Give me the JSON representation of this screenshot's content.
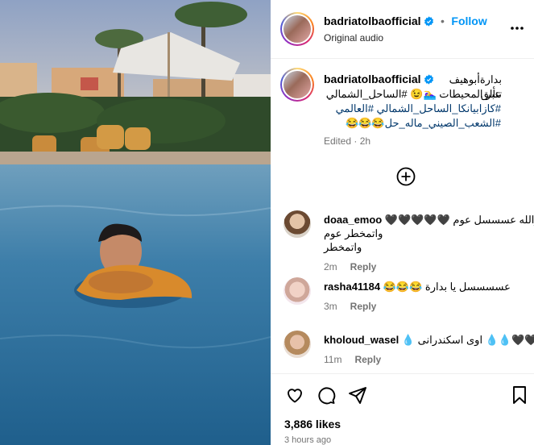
{
  "post": {
    "username": "badriatolbaofficial",
    "follow_label": "Follow",
    "audio_label": "Original audio",
    "more_icon": "more-horizontal-icon"
  },
  "caption": {
    "username": "badriatolbaofficial",
    "line1": "بدارة‌أبوهيف تتألق",
    "line2": "عبر المحيطات 🏊‍♀️😉 #الساحل_الشمالي",
    "line3": "#كازابيانكا_الساحل_الشمالي #العالمي",
    "line4": "#الشعب_الصيني_ماله_حل😂😂😂",
    "edited": "Edited · 2h"
  },
  "comments": [
    {
      "username": "doaa_emoo",
      "text_line1": "والله عسسسل عوم 🖤🖤🖤🖤🖤",
      "text_line2": "واتمخطر عوم واتمخطر",
      "time": "2m",
      "reply": "Reply"
    },
    {
      "username": "rasha41184",
      "text_line1": "عسسسسل يا بدارة 😂😂😂",
      "time": "3m",
      "reply": "Reply"
    },
    {
      "username": "kholoud_wasel",
      "text_line1": "🖤🖤💧💧 اوی اسکندرانی 💧",
      "time": "11m",
      "reply": "Reply"
    }
  ],
  "actions": {
    "like_icon": "heart-icon",
    "comment_icon": "comment-icon",
    "share_icon": "share-icon",
    "save_icon": "bookmark-icon"
  },
  "likes": "3,886 likes",
  "timestamp": "3 hours ago",
  "colors": {
    "link_blue": "#0095f6",
    "verified_blue": "#0095f6",
    "muted": "#737373",
    "pool_water": "#2f6f9b"
  }
}
